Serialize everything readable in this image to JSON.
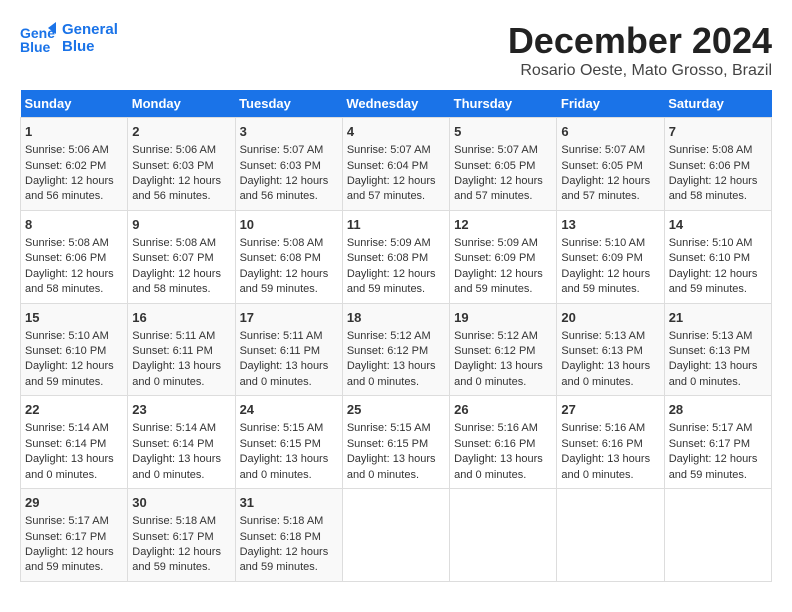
{
  "header": {
    "logo_line1": "General",
    "logo_line2": "Blue",
    "title": "December 2024",
    "subtitle": "Rosario Oeste, Mato Grosso, Brazil"
  },
  "days_of_week": [
    "Sunday",
    "Monday",
    "Tuesday",
    "Wednesday",
    "Thursday",
    "Friday",
    "Saturday"
  ],
  "weeks": [
    [
      {
        "day": 1,
        "sunrise": "5:06 AM",
        "sunset": "6:02 PM",
        "daylight": "12 hours and 56 minutes."
      },
      {
        "day": 2,
        "sunrise": "5:06 AM",
        "sunset": "6:03 PM",
        "daylight": "12 hours and 56 minutes."
      },
      {
        "day": 3,
        "sunrise": "5:07 AM",
        "sunset": "6:03 PM",
        "daylight": "12 hours and 56 minutes."
      },
      {
        "day": 4,
        "sunrise": "5:07 AM",
        "sunset": "6:04 PM",
        "daylight": "12 hours and 57 minutes."
      },
      {
        "day": 5,
        "sunrise": "5:07 AM",
        "sunset": "6:05 PM",
        "daylight": "12 hours and 57 minutes."
      },
      {
        "day": 6,
        "sunrise": "5:07 AM",
        "sunset": "6:05 PM",
        "daylight": "12 hours and 57 minutes."
      },
      {
        "day": 7,
        "sunrise": "5:08 AM",
        "sunset": "6:06 PM",
        "daylight": "12 hours and 58 minutes."
      }
    ],
    [
      {
        "day": 8,
        "sunrise": "5:08 AM",
        "sunset": "6:06 PM",
        "daylight": "12 hours and 58 minutes."
      },
      {
        "day": 9,
        "sunrise": "5:08 AM",
        "sunset": "6:07 PM",
        "daylight": "12 hours and 58 minutes."
      },
      {
        "day": 10,
        "sunrise": "5:08 AM",
        "sunset": "6:08 PM",
        "daylight": "12 hours and 59 minutes."
      },
      {
        "day": 11,
        "sunrise": "5:09 AM",
        "sunset": "6:08 PM",
        "daylight": "12 hours and 59 minutes."
      },
      {
        "day": 12,
        "sunrise": "5:09 AM",
        "sunset": "6:09 PM",
        "daylight": "12 hours and 59 minutes."
      },
      {
        "day": 13,
        "sunrise": "5:10 AM",
        "sunset": "6:09 PM",
        "daylight": "12 hours and 59 minutes."
      },
      {
        "day": 14,
        "sunrise": "5:10 AM",
        "sunset": "6:10 PM",
        "daylight": "12 hours and 59 minutes."
      }
    ],
    [
      {
        "day": 15,
        "sunrise": "5:10 AM",
        "sunset": "6:10 PM",
        "daylight": "12 hours and 59 minutes."
      },
      {
        "day": 16,
        "sunrise": "5:11 AM",
        "sunset": "6:11 PM",
        "daylight": "13 hours and 0 minutes."
      },
      {
        "day": 17,
        "sunrise": "5:11 AM",
        "sunset": "6:11 PM",
        "daylight": "13 hours and 0 minutes."
      },
      {
        "day": 18,
        "sunrise": "5:12 AM",
        "sunset": "6:12 PM",
        "daylight": "13 hours and 0 minutes."
      },
      {
        "day": 19,
        "sunrise": "5:12 AM",
        "sunset": "6:12 PM",
        "daylight": "13 hours and 0 minutes."
      },
      {
        "day": 20,
        "sunrise": "5:13 AM",
        "sunset": "6:13 PM",
        "daylight": "13 hours and 0 minutes."
      },
      {
        "day": 21,
        "sunrise": "5:13 AM",
        "sunset": "6:13 PM",
        "daylight": "13 hours and 0 minutes."
      }
    ],
    [
      {
        "day": 22,
        "sunrise": "5:14 AM",
        "sunset": "6:14 PM",
        "daylight": "13 hours and 0 minutes."
      },
      {
        "day": 23,
        "sunrise": "5:14 AM",
        "sunset": "6:14 PM",
        "daylight": "13 hours and 0 minutes."
      },
      {
        "day": 24,
        "sunrise": "5:15 AM",
        "sunset": "6:15 PM",
        "daylight": "13 hours and 0 minutes."
      },
      {
        "day": 25,
        "sunrise": "5:15 AM",
        "sunset": "6:15 PM",
        "daylight": "13 hours and 0 minutes."
      },
      {
        "day": 26,
        "sunrise": "5:16 AM",
        "sunset": "6:16 PM",
        "daylight": "13 hours and 0 minutes."
      },
      {
        "day": 27,
        "sunrise": "5:16 AM",
        "sunset": "6:16 PM",
        "daylight": "13 hours and 0 minutes."
      },
      {
        "day": 28,
        "sunrise": "5:17 AM",
        "sunset": "6:17 PM",
        "daylight": "12 hours and 59 minutes."
      }
    ],
    [
      {
        "day": 29,
        "sunrise": "5:17 AM",
        "sunset": "6:17 PM",
        "daylight": "12 hours and 59 minutes."
      },
      {
        "day": 30,
        "sunrise": "5:18 AM",
        "sunset": "6:17 PM",
        "daylight": "12 hours and 59 minutes."
      },
      {
        "day": 31,
        "sunrise": "5:18 AM",
        "sunset": "6:18 PM",
        "daylight": "12 hours and 59 minutes."
      },
      null,
      null,
      null,
      null
    ]
  ]
}
